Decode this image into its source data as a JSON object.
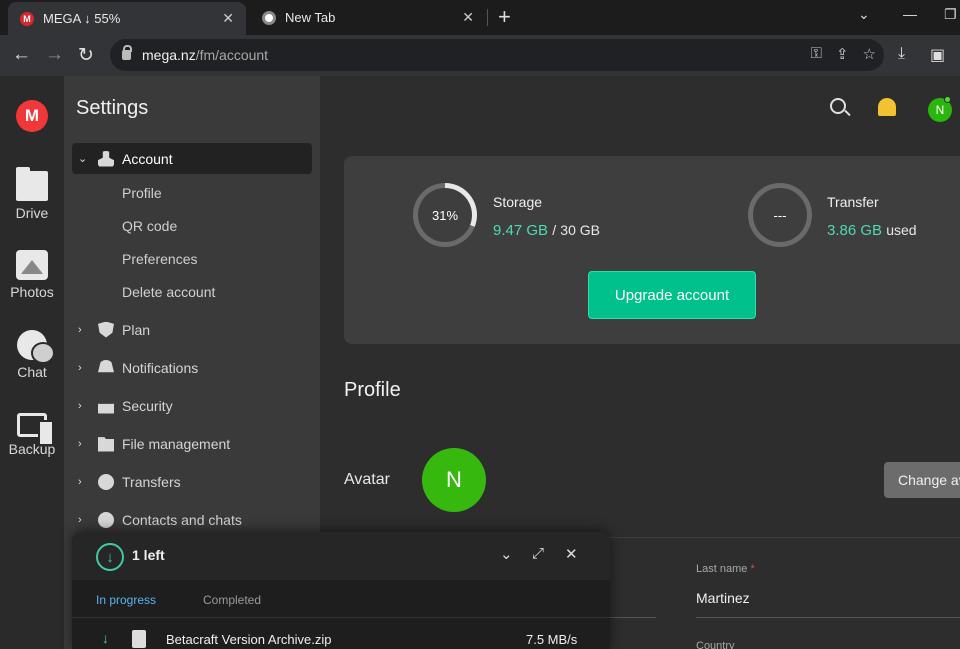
{
  "browser": {
    "tabs": [
      {
        "title": "MEGA ↓ 55%",
        "active": true
      },
      {
        "title": "New Tab",
        "active": false
      }
    ],
    "url_host": "mega.nz",
    "url_path": "/fm/account"
  },
  "rail": {
    "items": [
      {
        "label": "Drive",
        "icon": "folder-icon"
      },
      {
        "label": "Photos",
        "icon": "photo-icon"
      },
      {
        "label": "Chat",
        "icon": "chat-icon"
      },
      {
        "label": "Backup",
        "icon": "backup-icon"
      }
    ]
  },
  "settings": {
    "title": "Settings",
    "items": [
      {
        "label": "Account",
        "icon": "user-icon",
        "expanded": true
      },
      {
        "label": "Plan",
        "icon": "shield-icon"
      },
      {
        "label": "Notifications",
        "icon": "bell-icon"
      },
      {
        "label": "Security",
        "icon": "lock-icon"
      },
      {
        "label": "File management",
        "icon": "folder-icon"
      },
      {
        "label": "Transfers",
        "icon": "transfer-icon"
      },
      {
        "label": "Contacts and chats",
        "icon": "chat-icon"
      }
    ],
    "account_sub": [
      "Profile",
      "QR code",
      "Preferences",
      "Delete account"
    ]
  },
  "header": {
    "avatar_initial": "N"
  },
  "storage": {
    "label": "Storage",
    "percent_text": "31%",
    "percent": 31,
    "used": "9.47 GB",
    "separator": "/",
    "total": "30 GB"
  },
  "transfer": {
    "label": "Transfer",
    "ring_text": "---",
    "used": "3.86 GB",
    "suffix": "used"
  },
  "upgrade_label": "Upgrade account",
  "profile": {
    "section_title": "Profile",
    "avatar_label": "Avatar",
    "avatar_initial": "N",
    "change_label": "Change avatar",
    "last_name_label": "Last name",
    "last_name_required": "*",
    "last_name_value": "Martinez",
    "country_label": "Country"
  },
  "transfer_manager": {
    "count": "1 left",
    "tab_in_progress": "In progress",
    "tab_completed": "Completed",
    "file_name": "Betacraft Version Archive.zip",
    "speed": "7.5 MB/s"
  },
  "colors": {
    "accent": "#00c08b",
    "highlight_text": "#4ed8b5",
    "mega_red": "#f0373a",
    "avatar_green": "#36b80e"
  }
}
